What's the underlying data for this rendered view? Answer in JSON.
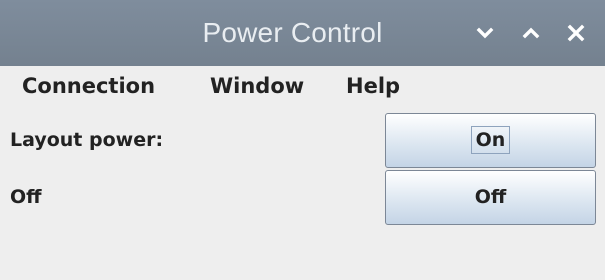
{
  "window": {
    "title": "Power Control"
  },
  "titlebar_buttons": {
    "minimize_icon": "chevron-down",
    "maximize_icon": "chevron-up",
    "close_icon": "x"
  },
  "menubar": {
    "items": [
      {
        "label": "Connection"
      },
      {
        "label": "Window"
      },
      {
        "label": "Help"
      }
    ]
  },
  "content": {
    "row1": {
      "label": "Layout power:",
      "button": "On"
    },
    "row2": {
      "label": "Off",
      "button": "Off"
    }
  },
  "colors": {
    "titlebar": "#7b8898",
    "title_text": "#e9edf1",
    "background": "#eeeeee",
    "button_border": "#7c8796"
  }
}
